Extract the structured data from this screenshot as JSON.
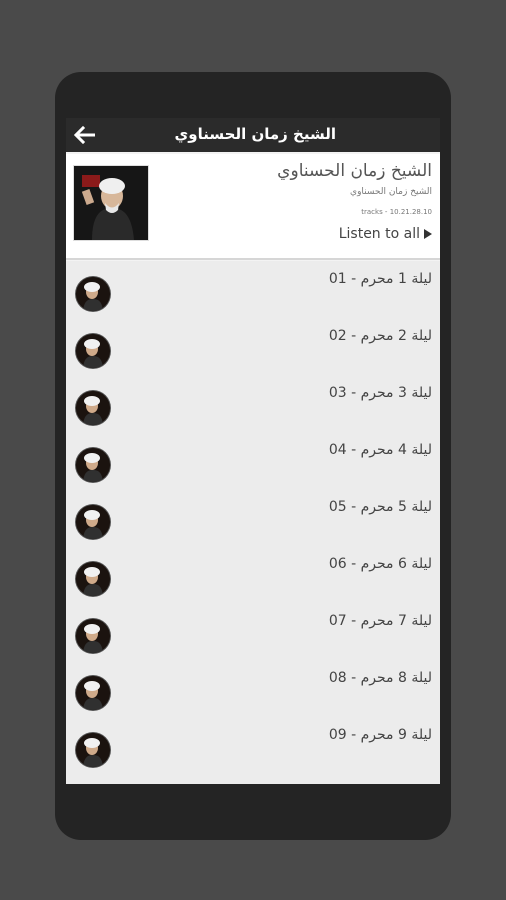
{
  "appbar": {
    "title": "الشيخ زمان الحسناوي"
  },
  "header": {
    "title": "الشيخ زمان الحسناوي",
    "subtitle": "الشيخ زمان الحسناوي",
    "meta": "tracks - 10.21.28.10",
    "listen_all": "Listen to all"
  },
  "tracks": [
    {
      "title": "01 - ليلة 1 محرم"
    },
    {
      "title": "02 - ليلة 2 محرم"
    },
    {
      "title": "03 - ليلة 3 محرم"
    },
    {
      "title": "04 - ليلة 4 محرم"
    },
    {
      "title": "05 - ليلة 5 محرم"
    },
    {
      "title": "06 - ليلة 6 محرم"
    },
    {
      "title": "07 - ليلة 7 محرم"
    },
    {
      "title": "08 - ليلة 8 محرم"
    },
    {
      "title": "09 - ليلة 9 محرم"
    }
  ],
  "icons": {
    "back": "arrow-left-icon",
    "play": "play-icon"
  },
  "colors": {
    "appbar": "#2b2b2b",
    "background": "#4a4a4a",
    "phone": "#242424",
    "list": "#ececec"
  }
}
